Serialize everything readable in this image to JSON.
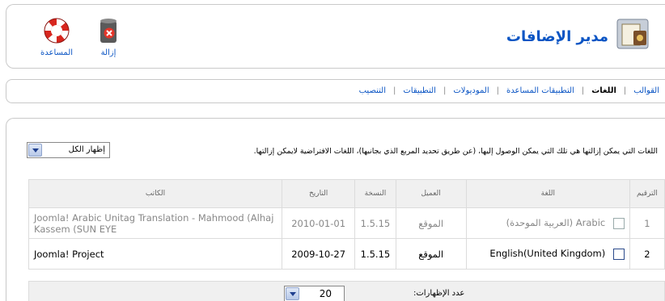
{
  "header": {
    "title": "مدير الإضافات",
    "toolbar": [
      {
        "label": "المساعدة",
        "icon": "help-lifebuoy-icon"
      },
      {
        "label": "إزالة",
        "icon": "trash-delete-icon"
      }
    ]
  },
  "submenu": {
    "items": [
      "التنصيب",
      "التطبيقات",
      "الموديولات",
      "التطبيقات المساعدة",
      "اللغات",
      "القوالب"
    ],
    "active": "اللغات"
  },
  "main": {
    "notice": "اللغات التي يمكن إزالتها هي تلك التي يمكن الوصول إليها، (عن طريق تحديد المربع الذي بجانبها)، اللغات الافتراضية لايمكن إزالتها.",
    "filter": {
      "selected": "إظهار الكل"
    },
    "table": {
      "headers": {
        "num": "الترقيم",
        "language": "اللغة",
        "client": "العميل",
        "version": "النسخة",
        "date": "التاريخ",
        "author": "الكاتب"
      },
      "rows": [
        {
          "num": "1",
          "language": "Arabic (العربية الموحدة)",
          "client": "الموقع",
          "version": "1.5.15",
          "date": "2010-01-01",
          "author": "Joomla! Arabic Unitag Translation - Mahmood (Alhaj Kassem (SUN EYE"
        },
        {
          "num": "2",
          "language": "(English(United Kingdom",
          "client": "الموقع",
          "version": "1.5.15",
          "date": "2009-10-27",
          "author": "Joomla! Project"
        }
      ]
    },
    "pagination": {
      "limit_label": "عدد الإظهارات:",
      "limit_value": "20"
    }
  },
  "colors": {
    "link": "#0b55c4",
    "border": "#c9c9c9",
    "header_bg": "#f0f0f0"
  }
}
